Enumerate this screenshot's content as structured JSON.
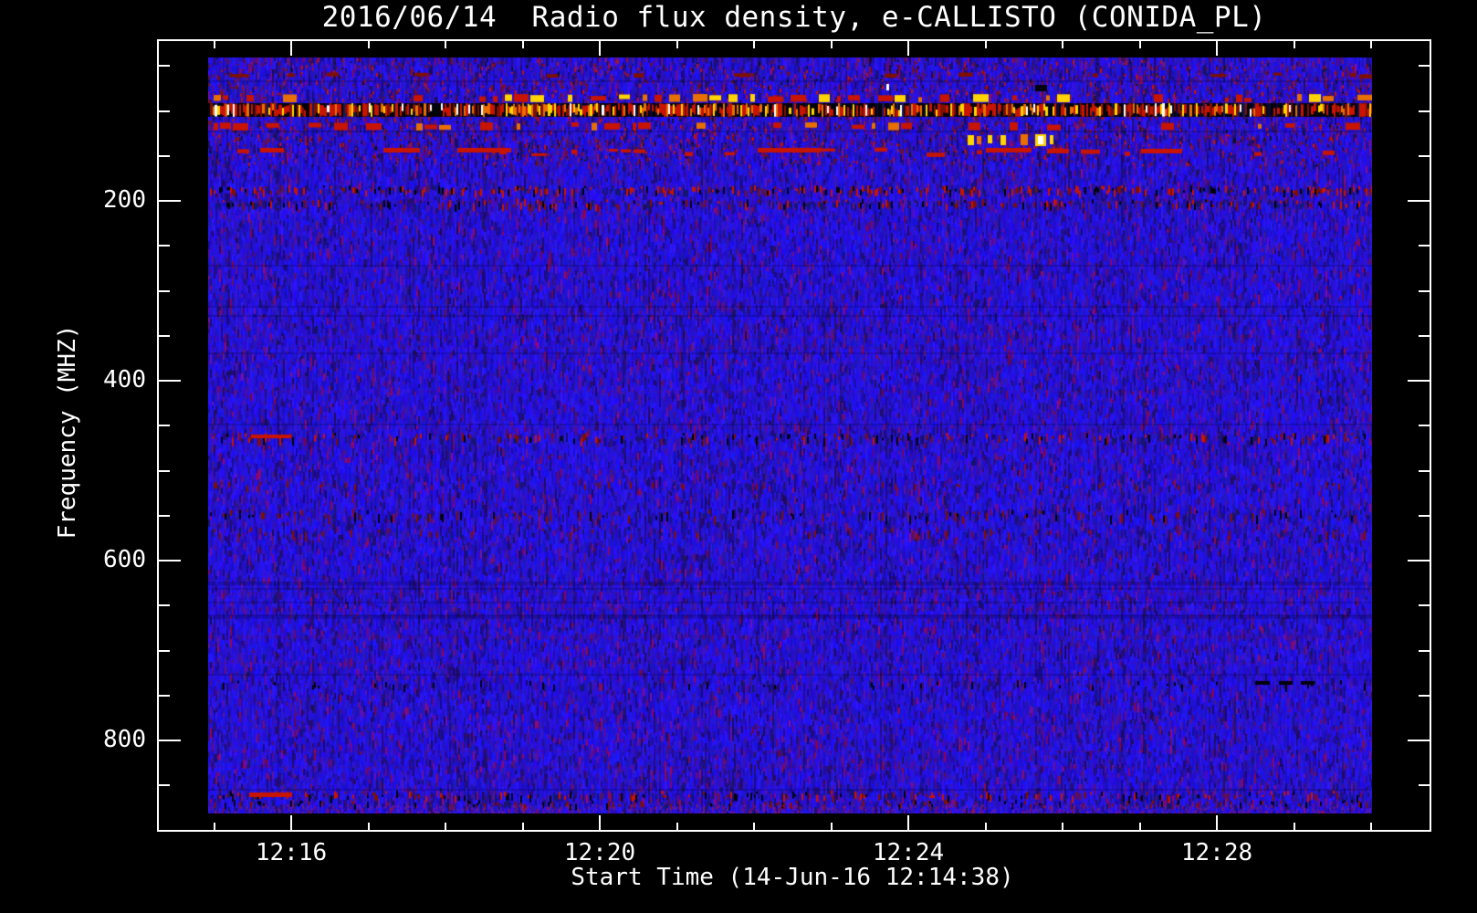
{
  "window": {
    "background": "#000000",
    "foreground": "#ffffff"
  },
  "chart_data": {
    "type": "heatmap",
    "subtype": "radio-spectrogram",
    "title": "2016/06/14  Radio flux density, e-CALLISTO (CONIDA_PL)",
    "xlabel": "Start Time (14-Jun-16 12:14:38)",
    "ylabel": "Frequency (MHZ)",
    "x_tick_labels": [
      "12:16",
      "12:20",
      "12:24",
      "12:28"
    ],
    "x_minor_tick_interval": "1 min",
    "x_start_time": "12:14:38",
    "x_end_time": "12:30:00",
    "y_tick_labels": [
      "200",
      "400",
      "600",
      "800"
    ],
    "y_minor_tick_interval_mhz": 50,
    "y_axis_direction": "inverted (low frequency at top)",
    "y_range_mhz": [
      41,
      880
    ],
    "legend": "none",
    "grid": "off",
    "palette": {
      "bg": "#000000",
      "base_blue": "#2323e2",
      "navy": "#16166e",
      "purple": "#5a2a9a",
      "redpurple": "#7a1a55",
      "red": "#c81400",
      "darkred": "#7e1000",
      "orange": "#e87000",
      "yellow": "#ffd400",
      "white": "#ffffff",
      "black": "#03030c"
    },
    "interference_bands": [
      {
        "freq_mhz": [
          57,
          64
        ],
        "level": "faint",
        "style": "dashes",
        "colors": [
          "darkred"
        ],
        "density": 0.1
      },
      {
        "freq_mhz": [
          71,
          79
        ],
        "level": "weak",
        "style": "specks",
        "colors": [
          "red",
          "darkred"
        ],
        "density": 0.1
      },
      {
        "freq_mhz": [
          82,
          91
        ],
        "level": "moderate",
        "style": "blobs",
        "colors": [
          "red",
          "red",
          "orange",
          "yellow"
        ],
        "density": 0.22
      },
      {
        "freq_mhz": [
          92,
          107
        ],
        "level": "strong",
        "style": "dense-rfi",
        "colors": [
          "red",
          "darkred",
          "orange",
          "yellow",
          "white"
        ],
        "density": 0.78,
        "note": "FM broadcast band, black with red/yellow bursts"
      },
      {
        "freq_mhz": [
          113,
          122
        ],
        "level": "moderate",
        "style": "blobs",
        "colors": [
          "red",
          "red",
          "orange"
        ],
        "density": 0.16
      },
      {
        "freq_mhz": [
          126,
          139
        ],
        "level": "weak",
        "style": "specks",
        "colors": [
          "red",
          "darkred"
        ],
        "density": 0.08
      },
      {
        "freq_mhz": [
          140,
          151
        ],
        "level": "moderate",
        "style": "dashes",
        "colors": [
          "red"
        ],
        "density": 0.14
      },
      {
        "freq_mhz": [
          183,
          191
        ],
        "level": "strong",
        "style": "speckle-band",
        "colors": [
          "red",
          "red",
          "darkred",
          "black",
          "navy"
        ],
        "density": 0.55
      },
      {
        "freq_mhz": [
          198,
          206
        ],
        "level": "moderate",
        "style": "speckle-band",
        "colors": [
          "darkred",
          "red",
          "black",
          "navy",
          "navy"
        ],
        "density": 0.48
      },
      {
        "freq_mhz": [
          457,
          466
        ],
        "level": "weak",
        "style": "speckle-band",
        "colors": [
          "darkred",
          "black",
          "navy",
          "red"
        ],
        "density": 0.3
      },
      {
        "freq_mhz": [
          511,
          518
        ],
        "level": "faint",
        "style": "speckle-band",
        "colors": [
          "navy",
          "darkred"
        ],
        "density": 0.15
      },
      {
        "freq_mhz": [
          542,
          552
        ],
        "level": "weak",
        "style": "speckle-band",
        "colors": [
          "black",
          "navy",
          "darkred"
        ],
        "density": 0.26
      },
      {
        "freq_mhz": [
          562,
          572
        ],
        "level": "faint",
        "style": "speckle-band",
        "colors": [
          "darkred",
          "navy"
        ],
        "density": 0.18
      },
      {
        "freq_mhz": [
          732,
          740
        ],
        "level": "faint",
        "style": "speckle-band",
        "colors": [
          "navy",
          "black"
        ],
        "density": 0.1
      },
      {
        "freq_mhz": [
          854,
          862
        ],
        "level": "weak",
        "style": "speckle-band",
        "colors": [
          "red",
          "darkred",
          "black",
          "navy"
        ],
        "density": 0.32
      },
      {
        "freq_mhz": [
          864,
          871
        ],
        "level": "weak",
        "style": "speckle-band",
        "colors": [
          "navy",
          "darkred",
          "black"
        ],
        "density": 0.28
      }
    ],
    "events": [
      {
        "name": "red-streak",
        "time": [
          "12:15:27",
          "12:16:01"
        ],
        "freq_mhz": [
          856,
          861
        ],
        "color": "red"
      },
      {
        "name": "red-streak",
        "time": [
          "12:15:29",
          "12:16:00"
        ],
        "freq_mhz": [
          459,
          463
        ],
        "color": "red"
      },
      {
        "name": "white-dash",
        "time": [
          "12:23:43",
          "12:23:45"
        ],
        "freq_mhz": [
          70,
          77
        ],
        "color": "white"
      },
      {
        "name": "black-blob",
        "time": [
          "12:25:39",
          "12:25:48"
        ],
        "freq_mhz": [
          71,
          78
        ],
        "color": "black"
      },
      {
        "name": "black-dash",
        "time": [
          "12:28:30",
          "12:28:41"
        ],
        "freq_mhz": [
          733,
          737
        ],
        "color": "black"
      },
      {
        "name": "black-dash",
        "time": [
          "12:28:48",
          "12:28:59"
        ],
        "freq_mhz": [
          733,
          737
        ],
        "color": "black"
      },
      {
        "name": "black-dash",
        "time": [
          "12:29:05",
          "12:29:16"
        ],
        "freq_mhz": [
          733,
          737
        ],
        "color": "black"
      },
      {
        "name": "yellow-burst",
        "time": [
          "12:24:46",
          "12:24:51"
        ],
        "freq_mhz": [
          127,
          138
        ],
        "color": "yellow"
      },
      {
        "name": "yellow-burst",
        "time": [
          "12:24:53",
          "12:24:57"
        ],
        "freq_mhz": [
          128,
          137
        ],
        "color": "orange"
      },
      {
        "name": "yellow-burst",
        "time": [
          "12:25:02",
          "12:25:05"
        ],
        "freq_mhz": [
          127,
          136
        ],
        "color": "yellow"
      },
      {
        "name": "yellow-burst",
        "time": [
          "12:25:12",
          "12:25:16"
        ],
        "freq_mhz": [
          127,
          138
        ],
        "color": "yellow"
      },
      {
        "name": "yellow-burst",
        "time": [
          "12:25:27",
          "12:25:33"
        ],
        "freq_mhz": [
          126,
          138
        ],
        "color": "orange"
      },
      {
        "name": "yellow-burst",
        "time": [
          "12:25:39",
          "12:25:47"
        ],
        "freq_mhz": [
          126,
          139
        ],
        "color": "yellow",
        "core": "white"
      },
      {
        "name": "yellow-burst",
        "time": [
          "12:25:50",
          "12:25:53"
        ],
        "freq_mhz": [
          127,
          137
        ],
        "color": "yellow"
      },
      {
        "name": "red-dash",
        "time": [
          "12:15:36",
          "12:15:54"
        ],
        "freq_mhz": [
          141,
          146
        ],
        "color": "red"
      },
      {
        "name": "red-dash",
        "time": [
          "12:17:12",
          "12:17:40"
        ],
        "freq_mhz": [
          141,
          146
        ],
        "color": "red"
      },
      {
        "name": "red-dash",
        "time": [
          "12:18:09",
          "12:18:51"
        ],
        "freq_mhz": [
          141,
          146
        ],
        "color": "red"
      },
      {
        "name": "red-dash",
        "time": [
          "12:22:03",
          "12:22:52"
        ],
        "freq_mhz": [
          141,
          146
        ],
        "color": "red"
      },
      {
        "name": "red-dash",
        "time": [
          "12:25:00",
          "12:25:36"
        ],
        "freq_mhz": [
          141,
          146
        ],
        "color": "red"
      },
      {
        "name": "red-dash",
        "time": [
          "12:25:48",
          "12:26:05"
        ],
        "freq_mhz": [
          142,
          147
        ],
        "color": "red"
      },
      {
        "name": "red-dash",
        "time": [
          "12:27:01",
          "12:27:33"
        ],
        "freq_mhz": [
          142,
          147
        ],
        "color": "red"
      }
    ]
  }
}
